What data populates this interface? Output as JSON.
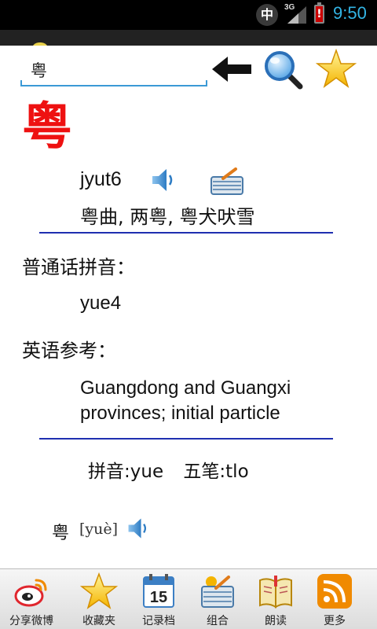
{
  "status_bar": {
    "ime_label": "中",
    "network": "3G",
    "battery_mark": "!",
    "time": "9:50"
  },
  "search": {
    "value": "粤",
    "back_icon": "back-arrow-icon",
    "search_icon": "magnifier-icon",
    "favorite_icon": "star-icon"
  },
  "entry": {
    "character": "粤",
    "jyutping": "jyut6",
    "examples": "粤曲, 两粤, 粤犬吠雪",
    "mandarin_label": "普通话拼音：",
    "mandarin_pinyin": "yue4",
    "english_label": "英语参考：",
    "english_meaning": "Guangdong and Guangxi provinces; initial particle",
    "pinyin_code": "拼音:yue",
    "wubi_code": "五笔:tlo",
    "bottom_char": "粤",
    "bottom_pinyin": "[yuè]"
  },
  "tabs": [
    {
      "label": "分享微博",
      "icon": "weibo-icon"
    },
    {
      "label": "收藏夹",
      "icon": "star-icon"
    },
    {
      "label": "记录档",
      "icon": "calendar-icon",
      "day": "15"
    },
    {
      "label": "组合",
      "icon": "basket-icon"
    },
    {
      "label": "朗读",
      "icon": "book-icon"
    },
    {
      "label": "更多",
      "icon": "rss-icon"
    }
  ],
  "colors": {
    "headword": "#ee1111",
    "divider": "#1f2fb0",
    "input_underline": "#3b9ad6",
    "clock": "#33b5e5"
  }
}
